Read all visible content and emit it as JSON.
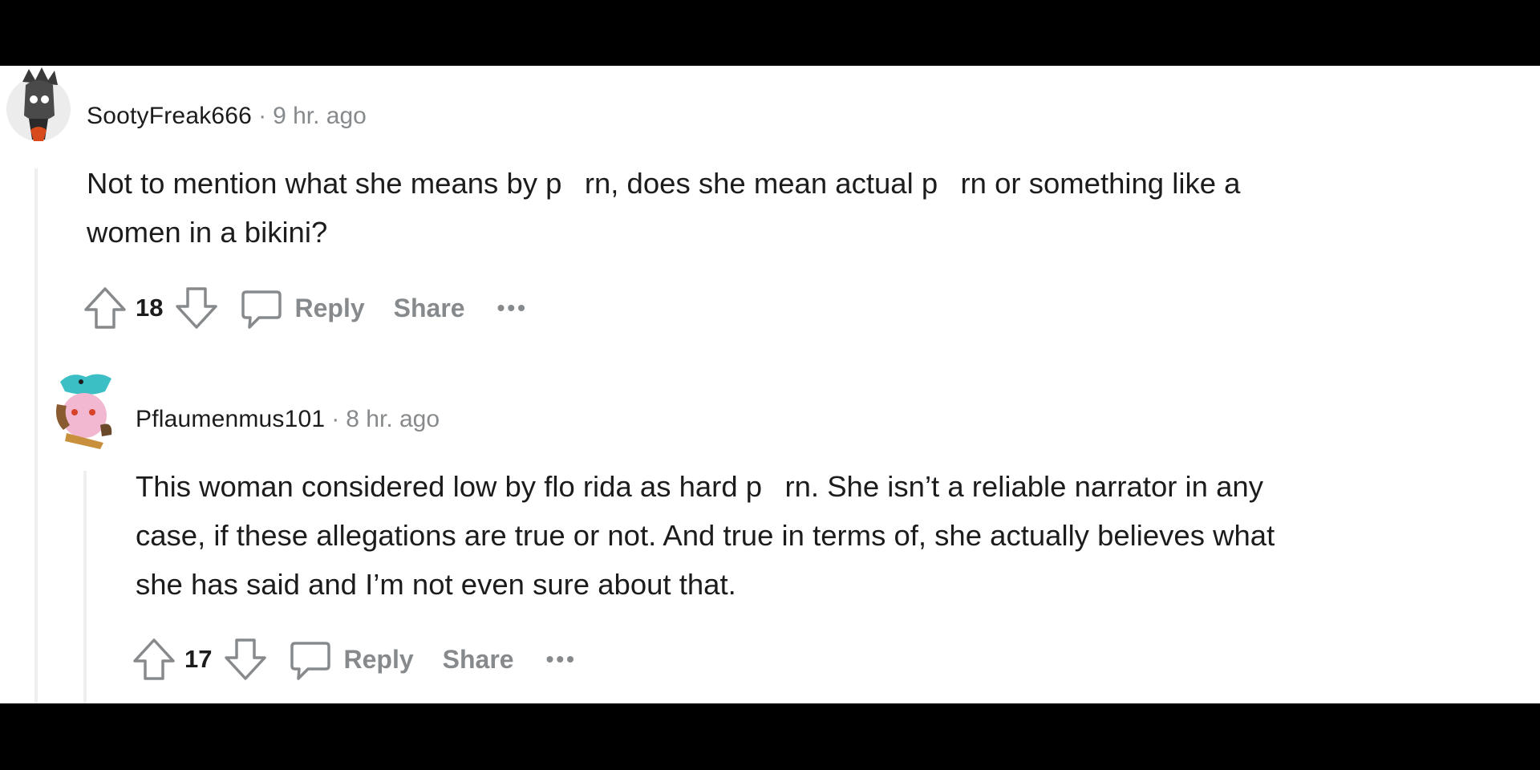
{
  "comments": [
    {
      "username": "SootyFreak666",
      "separator": "·",
      "timestamp": "9 hr. ago",
      "body_line1": "Not to mention what she means by p  rn, does she mean actual p  rn or something like a",
      "body_line2": "women in a bikini?",
      "votes": "18",
      "reply_label": "Reply",
      "share_label": "Share",
      "more_label": "•••",
      "avatar_colors": {
        "bg": "#ececec",
        "accent": "#d84a1b",
        "dark": "#3a3a3a"
      }
    },
    {
      "username": "Pflaumenmus101",
      "separator": "·",
      "timestamp": "8 hr. ago",
      "body_line1": "This woman considered low by flo rida as hard p  rn. She isn’t a reliable narrator in any",
      "body_line2": "case, if these allegations are true or not. And true in terms of, she actually believes what",
      "body_line3": "she has said and I’m not even sure about that.",
      "votes": "17",
      "reply_label": "Reply",
      "share_label": "Share",
      "more_label": "•••",
      "avatar_colors": {
        "bg": "#f2b8d2",
        "accent": "#3bbfc4",
        "dark": "#6a4a2a"
      }
    }
  ]
}
